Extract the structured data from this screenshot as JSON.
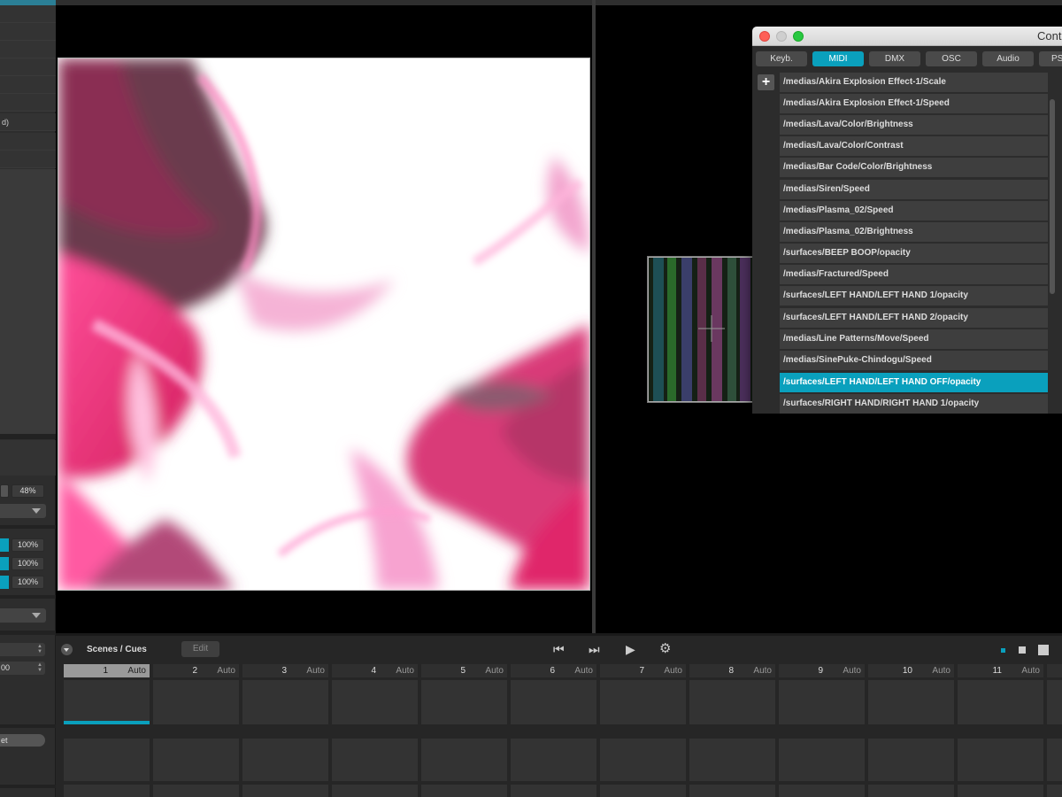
{
  "left_panel": {
    "rows": [
      "",
      "",
      "",
      "",
      "",
      "",
      "d)",
      "",
      ""
    ],
    "opacity_value": "48%",
    "color_values": [
      "100%",
      "100%",
      "100%"
    ],
    "spin_values": [
      "",
      "00"
    ],
    "pill_label": "et"
  },
  "controls_window": {
    "title": "Cont",
    "tabs": [
      "Keyb.",
      "MIDI",
      "DMX",
      "OSC",
      "Audio",
      "PS"
    ],
    "active_tab": "MIDI",
    "add_label": "+",
    "items": [
      "/medias/Akira Explosion Effect-1/Scale",
      "/medias/Akira Explosion Effect-1/Speed",
      "/medias/Lava/Color/Brightness",
      "/medias/Lava/Color/Contrast",
      "/medias/Bar Code/Color/Brightness",
      "/medias/Siren/Speed",
      "/medias/Plasma_02/Speed",
      "/medias/Plasma_02/Brightness",
      "/surfaces/BEEP BOOP/opacity",
      "/medias/Fractured/Speed",
      "/surfaces/LEFT HAND/LEFT HAND 1/opacity",
      "/surfaces/LEFT HAND/LEFT HAND 2/opacity",
      "/medias/Line Patterns/Move/Speed",
      "/medias/SinePuke-Chindogu/Speed",
      "/surfaces/LEFT HAND/LEFT HAND OFF/opacity",
      "/surfaces/RIGHT HAND/RIGHT HAND 1/opacity"
    ],
    "selected_item": "/surfaces/LEFT HAND/LEFT HAND OFF/opacity"
  },
  "scenes": {
    "title": "Scenes / Cues",
    "edit_label": "Edit",
    "controls": {
      "prev": "⏮",
      "next": "⏭",
      "play": "▶",
      "settings": "⚙"
    },
    "cues": [
      {
        "num": "1",
        "mode": "Auto"
      },
      {
        "num": "2",
        "mode": "Auto"
      },
      {
        "num": "3",
        "mode": "Auto"
      },
      {
        "num": "4",
        "mode": "Auto"
      },
      {
        "num": "5",
        "mode": "Auto"
      },
      {
        "num": "6",
        "mode": "Auto"
      },
      {
        "num": "7",
        "mode": "Auto"
      },
      {
        "num": "8",
        "mode": "Auto"
      },
      {
        "num": "9",
        "mode": "Auto"
      },
      {
        "num": "10",
        "mode": "Auto"
      },
      {
        "num": "11",
        "mode": "Auto"
      }
    ],
    "active_cue": "1",
    "active_cue_progress": 1.0
  },
  "colors": {
    "accent": "#0aa0bd",
    "background": "#262626",
    "fluid_pink": "#e8347a"
  }
}
